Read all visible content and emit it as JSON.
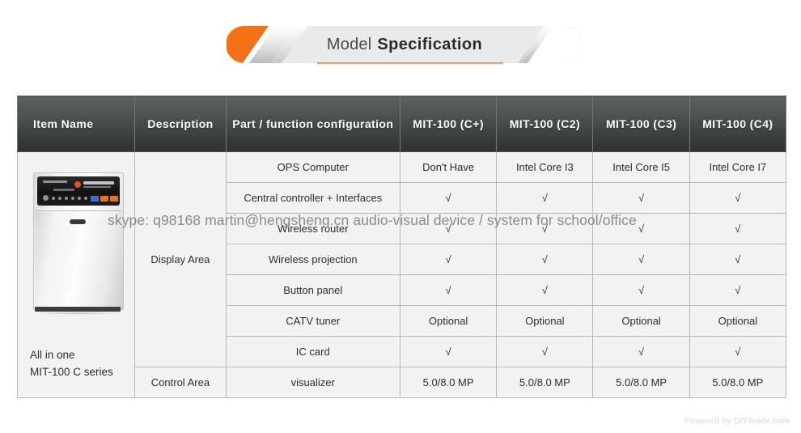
{
  "banner": {
    "title_light": "Model",
    "title_bold": "Specification",
    "accent_color": "#f47216",
    "panel_color": "#d8d9db"
  },
  "table": {
    "headers": [
      "Item Name",
      "Description",
      "Part / function configuration",
      "MIT-100 (C+)",
      "MIT-100 (C2)",
      "MIT-100 (C3)",
      "MIT-100 (C4)"
    ],
    "item": {
      "name_line1": "All in one",
      "name_line2": "MIT-100 C series",
      "image_alt": "all-in-one-cabinet"
    },
    "descriptions": {
      "display_area": "Display Area",
      "control_area": "Control Area"
    },
    "check_glyph": "√",
    "rows": [
      {
        "part": "OPS Computer",
        "values": [
          "Don't Have",
          "Intel Core I3",
          "Intel Core I5",
          "Intel Core I7"
        ]
      },
      {
        "part": "Central controller + Interfaces",
        "values": [
          "√",
          "√",
          "√",
          "√"
        ]
      },
      {
        "part": "Wireless router",
        "values": [
          "√",
          "√",
          "√",
          "√"
        ]
      },
      {
        "part": "Wireless projection",
        "values": [
          "√",
          "√",
          "√",
          "√"
        ]
      },
      {
        "part": "Button panel",
        "values": [
          "√",
          "√",
          "√",
          "√"
        ]
      },
      {
        "part": "CATV tuner",
        "values": [
          "Optional",
          "Optional",
          "Optional",
          "Optional"
        ]
      },
      {
        "part": "IC card",
        "values": [
          "√",
          "√",
          "√",
          "√"
        ]
      },
      {
        "part": "visualizer",
        "values": [
          "5.0/8.0 MP",
          "5.0/8.0 MP",
          "5.0/8.0 MP",
          "5.0/8.0 MP"
        ]
      }
    ]
  },
  "watermark": {
    "text": "skype: q98168 martin@hengsheng.cn audio-visual device / system for school/office"
  },
  "footer": {
    "credit": "Powered by DIYTrade.com"
  }
}
